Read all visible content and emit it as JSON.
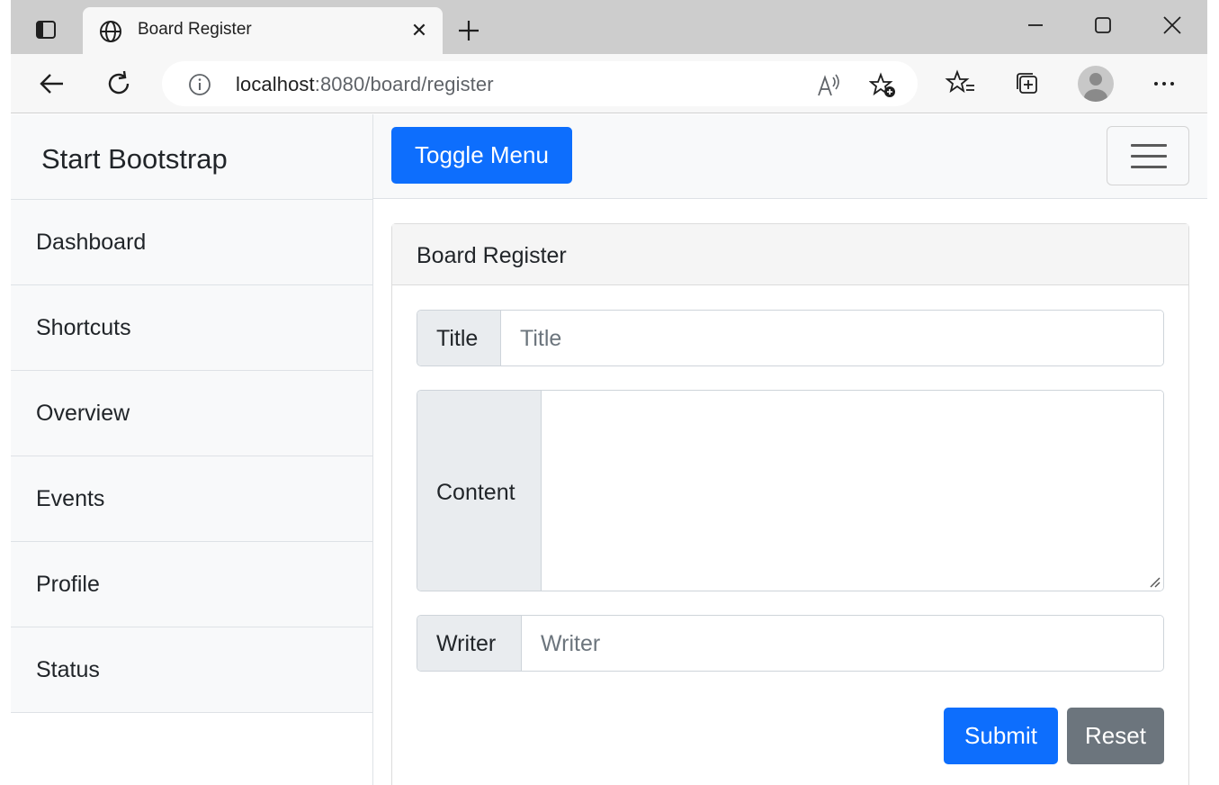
{
  "browser": {
    "tab_title": "Board Register",
    "url_host": "localhost",
    "url_rest": ":8080/board/register"
  },
  "sidebar": {
    "heading": "Start Bootstrap",
    "items": [
      {
        "label": "Dashboard"
      },
      {
        "label": "Shortcuts"
      },
      {
        "label": "Overview"
      },
      {
        "label": "Events"
      },
      {
        "label": "Profile"
      },
      {
        "label": "Status"
      }
    ]
  },
  "topnav": {
    "toggle_label": "Toggle Menu"
  },
  "card": {
    "header": "Board Register",
    "title_label": "Title",
    "title_placeholder": "Title",
    "content_label": "Content",
    "writer_label": "Writer",
    "writer_placeholder": "Writer",
    "submit_label": "Submit",
    "reset_label": "Reset"
  },
  "colors": {
    "primary": "#0d6efd",
    "secondary": "#6c757d",
    "light_bg": "#f8f9fa",
    "addon_bg": "#e9ecef"
  }
}
